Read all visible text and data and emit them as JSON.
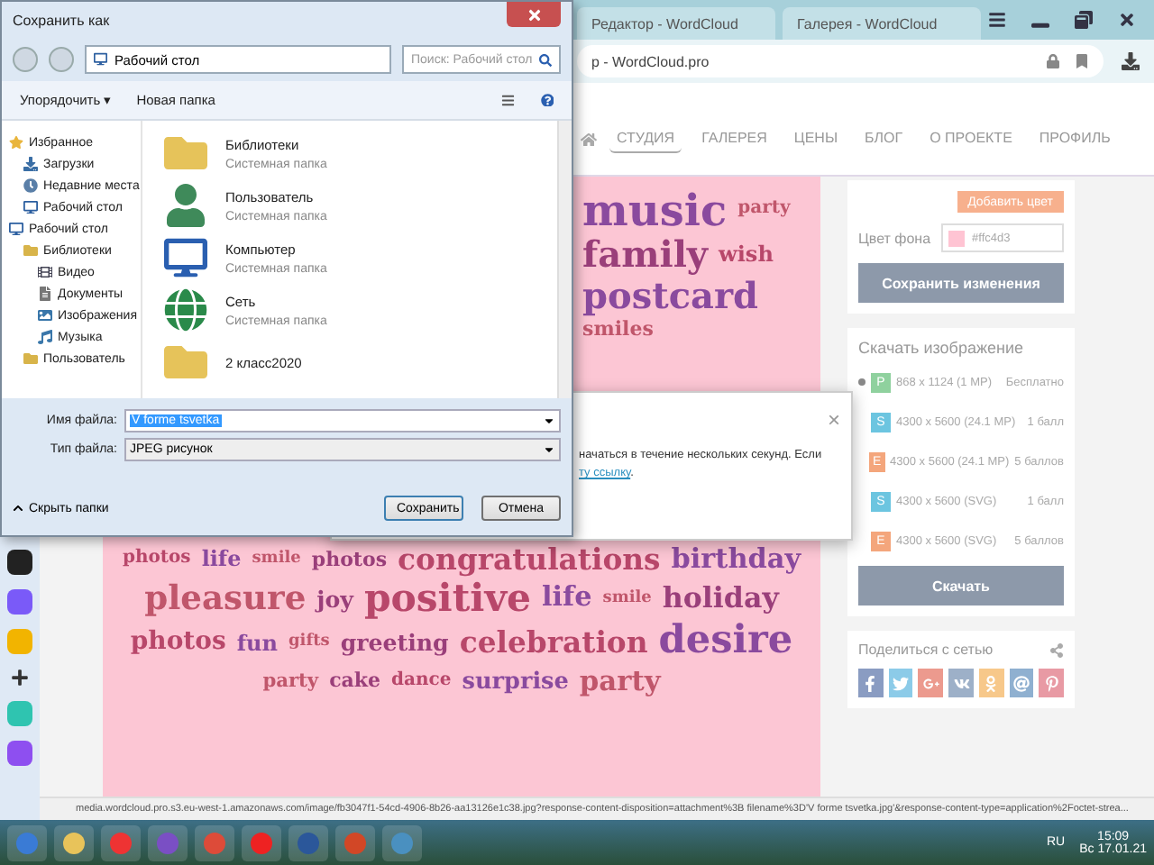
{
  "browser": {
    "tabs": [
      {
        "title": "Редактор - WordCloud",
        "selected": false
      },
      {
        "title": "Галерея - WordCloud",
        "selected": false
      }
    ],
    "address": "p - WordCloud.pro",
    "nav": [
      {
        "label": "СТУДИЯ",
        "selected": true
      },
      {
        "label": "ГАЛЕРЕЯ",
        "selected": false
      },
      {
        "label": "ЦЕНЫ",
        "selected": false
      },
      {
        "label": "БЛОГ",
        "selected": false
      },
      {
        "label": "О ПРОЕКТЕ",
        "selected": false
      },
      {
        "label": "ПРОФИЛЬ",
        "selected": false
      }
    ],
    "cloud_words_top": [
      "music",
      "party",
      "family",
      "wish",
      "postcard",
      "smiles"
    ],
    "cloud_words": [
      "photos",
      "life",
      "smile",
      "photos",
      "congratulations",
      "birthday",
      "pleasure",
      "joy",
      "positive",
      "life",
      "smile",
      "holiday",
      "photos",
      "fun",
      "gifts",
      "greeting",
      "celebration",
      "desire",
      "party",
      "cake",
      "dance",
      "surprise",
      "party"
    ],
    "panel": {
      "add_button": "Добавить цвет",
      "bg_label": "Цвет фона",
      "bg_value": "#ffc4d3",
      "save_button": "Сохранить изменения",
      "download_title": "Скачать изображение",
      "options": [
        {
          "badge": "P",
          "color": "#8fd19e",
          "size": "868 x 1124 (1 MP)",
          "price": "Бесплатно",
          "selected": true
        },
        {
          "badge": "S",
          "color": "#6cc5e0",
          "size": "4300 x 5600 (24.1 MP)",
          "price": "1 балл",
          "selected": false
        },
        {
          "badge": "E",
          "color": "#f4a67c",
          "size": "4300 x 5600 (24.1 MP)",
          "price": "5 баллов",
          "selected": false
        },
        {
          "badge": "S",
          "color": "#6cc5e0",
          "size": "4300 x 5600 (SVG)",
          "price": "1 балл",
          "selected": false
        },
        {
          "badge": "E",
          "color": "#f4a67c",
          "size": "4300 x 5600 (SVG)",
          "price": "5 баллов",
          "selected": false
        }
      ],
      "download_button": "Скачать",
      "share_title": "Поделиться с сетью"
    },
    "status_url": "media.wordcloud.pro.s3.eu-west-1.amazonaws.com/image/fb3047f1-54cd-4906-8b26-aa13126e1c38.jpg?response-content-disposition=attachment%3B filename%3D'V forme tsvetka.jpg'&response-content-type=application%2Foctet-strea..."
  },
  "popup": {
    "line": "начаться в течение нескольких секунд. Если",
    "link": "ту ссылку",
    "tail": ".",
    "close": "×"
  },
  "dialog": {
    "title": "Сохранить как",
    "path": "Рабочий стол",
    "search_placeholder": "Поиск: Рабочий стол",
    "organize": "Упорядочить ▾",
    "new_folder": "Новая папка",
    "nav": [
      {
        "label": "Избранное",
        "kind": "star",
        "children": [
          {
            "label": "Загрузки",
            "kind": "download"
          },
          {
            "label": "Недавние места",
            "kind": "recent"
          },
          {
            "label": "Рабочий стол",
            "kind": "desktop"
          }
        ]
      },
      {
        "label": "Рабочий стол",
        "kind": "desktop",
        "children": [
          {
            "label": "Библиотеки",
            "kind": "library",
            "children": [
              {
                "label": "Видео",
                "kind": "video"
              },
              {
                "label": "Документы",
                "kind": "doc"
              },
              {
                "label": "Изображения",
                "kind": "image"
              },
              {
                "label": "Музыка",
                "kind": "music"
              }
            ]
          },
          {
            "label": "Пользователь",
            "kind": "folder"
          }
        ]
      }
    ],
    "files": [
      {
        "name": "Библиотеки",
        "type": "Системная папка",
        "kind": "library"
      },
      {
        "name": "Пользователь",
        "type": "Системная папка",
        "kind": "user"
      },
      {
        "name": "Компьютер",
        "type": "Системная папка",
        "kind": "computer"
      },
      {
        "name": "Сеть",
        "type": "Системная папка",
        "kind": "network"
      },
      {
        "name": "2 класс2020",
        "kind": "folder"
      }
    ],
    "filename_label": "Имя файла:",
    "filename": "V forme tsvetka",
    "filetype_label": "Тип файла:",
    "filetype": "JPEG рисунок",
    "hide_folders": "Скрыть папки",
    "save": "Сохранить",
    "cancel": "Отмена"
  },
  "taskbar": {
    "lang": "RU",
    "time": "15:09",
    "date": "Вс 17.01.21"
  }
}
